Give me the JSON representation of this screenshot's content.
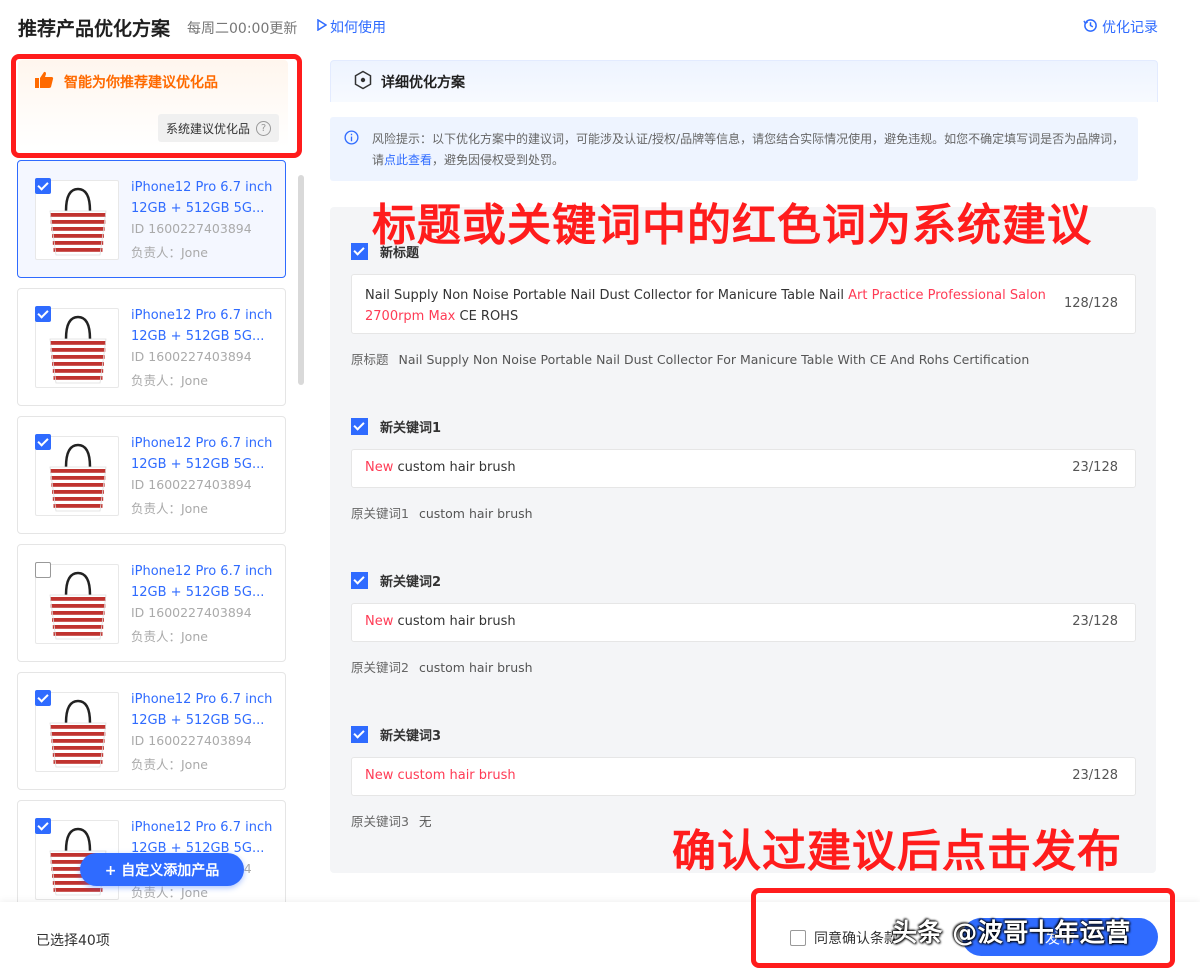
{
  "header": {
    "title": "推荐产品优化方案",
    "update_note": "每周二00:00更新",
    "howto_label": "如何使用",
    "history_label": "优化记录"
  },
  "smart": {
    "title": "智能为你推荐建议优化品",
    "sys_button": "系统建议优化品",
    "help": "?"
  },
  "products": [
    {
      "name": "iPhone12 Pro 6.7 inch 12GB + 512GB 5G...",
      "id": "ID 1600227403894",
      "owner": "负责人：Jone",
      "checked": true
    },
    {
      "name": "iPhone12 Pro 6.7 inch 12GB + 512GB 5G...",
      "id": "ID 1600227403894",
      "owner": "负责人：Jone",
      "checked": true
    },
    {
      "name": "iPhone12 Pro 6.7 inch 12GB + 512GB 5G...",
      "id": "ID 1600227403894",
      "owner": "负责人：Jone",
      "checked": true
    },
    {
      "name": "iPhone12 Pro 6.7 inch 12GB + 512GB 5G...",
      "id": "ID 1600227403894",
      "owner": "负责人：Jone",
      "checked": false
    },
    {
      "name": "iPhone12 Pro 6.7 inch 12GB + 512GB 5G...",
      "id": "ID 1600227403894",
      "owner": "负责人：Jone",
      "checked": true
    },
    {
      "name": "iPhone12 Pro 6.7 inch 12GB + 512GB 5G...",
      "id": "ID 1600227403894",
      "owner": "负责人：Jone",
      "checked": true
    }
  ],
  "add_button": "+ 自定义添加产品",
  "detail": {
    "heading": "详细优化方案",
    "risk_text": "风险提示：以下优化方案中的建议词，可能涉及认证/授权/品牌等信息，请您结合实际情况使用，避免违规。如您不确定填写词是否为品牌词，请",
    "risk_link": "点此查看",
    "risk_tail": "，避免因侵权受到处罚。",
    "annotation_top": "标题或关键词中的红色词为系统建议",
    "annotation_bottom": "确认过建议后点击发布",
    "title_section": {
      "label": "新标题",
      "value_plain": "Nail Supply Non Noise Portable Nail Dust Collector for Manicure Table Nail ",
      "value_highlight": "Art Practice Professional Salon 2700rpm Max",
      "value_tail": " CE ROHS",
      "counter": "128/128",
      "orig_label": "原标题",
      "orig_value": "Nail Supply Non Noise Portable Nail Dust Collector For Manicure Table With CE And Rohs Certification"
    },
    "keywords": [
      {
        "label": "新关键词1",
        "highlight": "New",
        "plain": " custom hair brush",
        "counter": "23/128",
        "orig_label": "原关键词1",
        "orig_value": "custom hair brush"
      },
      {
        "label": "新关键词2",
        "highlight": "New",
        "plain": " custom hair brush",
        "counter": "23/128",
        "orig_label": "原关键词2",
        "orig_value": "custom hair brush"
      },
      {
        "label": "新关键词3",
        "highlight": "New custom hair brush",
        "plain": "",
        "counter": "23/128",
        "orig_label": "原关键词3",
        "orig_value": "无"
      }
    ]
  },
  "footer": {
    "selected": "已选择40项",
    "agree": "同意确认条款",
    "publish": "发布"
  },
  "watermark": "头条 @波哥十年运营",
  "colors": {
    "accent": "#2f6bff",
    "highlight": "#ff3b55",
    "annotation": "#ff1c1c",
    "smart": "#ff6a00"
  }
}
